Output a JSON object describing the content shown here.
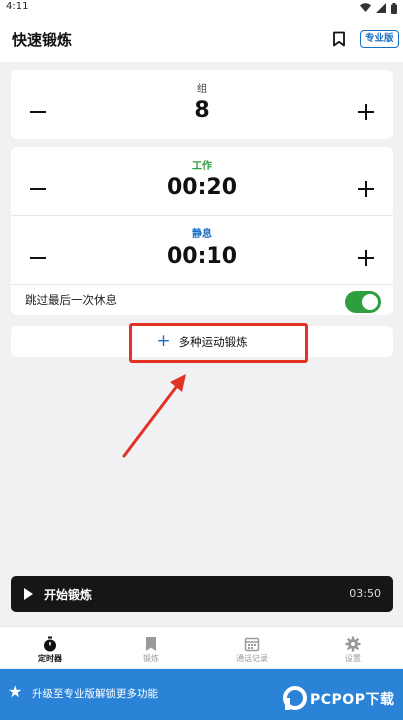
{
  "status_bar": {
    "time": "4:11",
    "icons": [
      "wifi-icon",
      "signal-icon",
      "battery-icon"
    ]
  },
  "app_bar": {
    "title": "快速锻炼",
    "bookmark_icon": "bookmark-icon",
    "pro_badge": "专业版"
  },
  "sets": {
    "label": "组",
    "value": "8"
  },
  "work": {
    "label": "工作",
    "value": "00:20",
    "color": "#2e9e3e"
  },
  "rest": {
    "label": "静息",
    "value": "00:10",
    "color": "#1a6fc4"
  },
  "skip_last_rest": {
    "label": "跳过最后一次休息",
    "enabled": true
  },
  "multi_exercise": {
    "label": "多种运动锻炼"
  },
  "start": {
    "label": "开始锻炼",
    "total": "03:50"
  },
  "nav": [
    {
      "label": "定时器",
      "icon": "stopwatch-icon",
      "active": true
    },
    {
      "label": "锻炼",
      "icon": "bookmark-icon",
      "active": false
    },
    {
      "label": "通话记录",
      "icon": "calendar-icon",
      "active": false
    },
    {
      "label": "设置",
      "icon": "gear-icon",
      "active": false
    }
  ],
  "promo": {
    "text": "升级至专业版解锁更多功能",
    "watermark": "PCPOP下载"
  },
  "colors": {
    "accent": "#1a6fc4",
    "toggle_on": "#2e9e3e",
    "highlight": "#e23226",
    "promo_bg": "#2a83d6"
  }
}
